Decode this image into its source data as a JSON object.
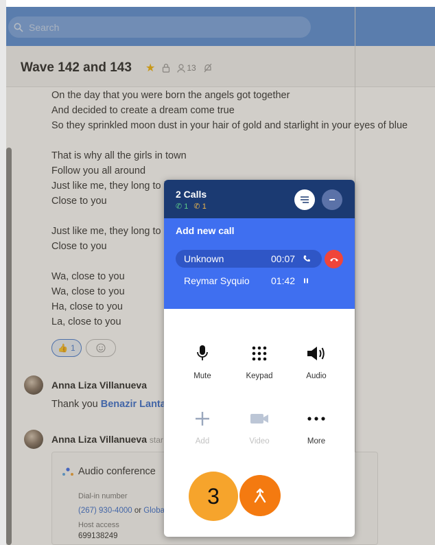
{
  "search": {
    "placeholder": "Search"
  },
  "conversation": {
    "title": "Wave 142 and 143",
    "member_count": "13"
  },
  "lyrics": [
    [
      "On the day that you were born the angels got together",
      "And decided to create a dream come true",
      "So they sprinkled moon dust in your hair of gold and starlight in your eyes of blue"
    ],
    [
      "That is why all the girls in town",
      "Follow you all around",
      "Just like me, they long to b",
      "Close to you"
    ],
    [
      "Just like me, they long to b",
      "Close to you"
    ],
    [
      "Wa, close to you",
      "Wa, close to you",
      "Ha, close to you",
      "La, close to you"
    ]
  ],
  "reactions": {
    "thumbs_count": "1"
  },
  "messages": [
    {
      "name": "Anna Liza Villanueva",
      "text_prefix": "Thank you ",
      "mention": "Benazir Lantan"
    },
    {
      "name": "Anna Liza Villanueva",
      "suffix": "star"
    }
  ],
  "conference": {
    "title": "Audio conference",
    "dialin_label": "Dial-in number",
    "dialin_number": "(267) 930-4000",
    "dialin_or": "or",
    "dialin_global": "Globa",
    "host_label": "Host access",
    "host_code": "699138249"
  },
  "call_panel": {
    "title": "2 Calls",
    "active_count": "1",
    "held_count": "1",
    "add_call": "Add new call",
    "calls": [
      {
        "name": "Unknown",
        "time": "00:07"
      },
      {
        "name": "Reymar Syquio",
        "time": "01:42"
      }
    ],
    "controls": {
      "mute": "Mute",
      "keypad": "Keypad",
      "audio": "Audio",
      "add": "Add",
      "video": "Video",
      "more": "More"
    }
  },
  "badge": {
    "number": "3"
  },
  "colors": {
    "header_navy": "#1b3a72",
    "call_blue": "#3f6ff0",
    "hangup_red": "#f0453a",
    "merge_orange": "#f47a10",
    "badge_orange": "#f6a42c",
    "star_gold": "#f2b40b"
  }
}
